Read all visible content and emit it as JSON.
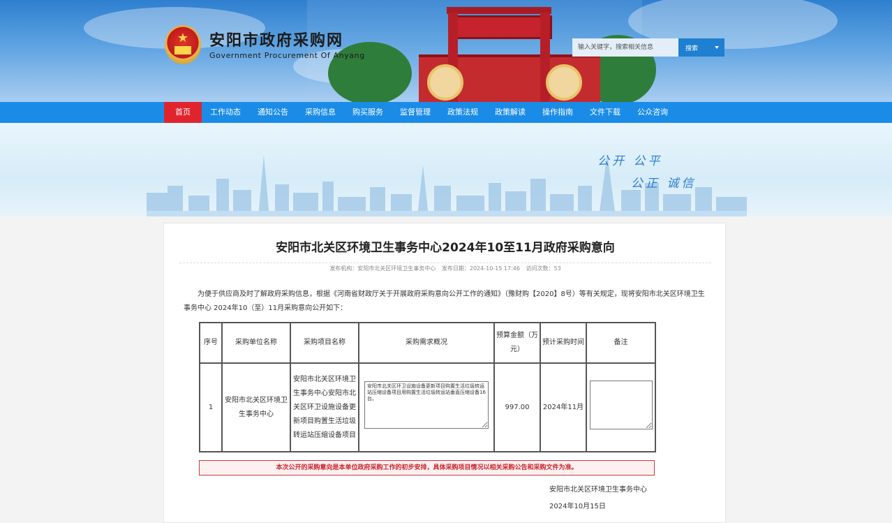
{
  "header": {
    "site_title": "安阳市政府采购网",
    "site_subtitle": "Government Procurement Of Anyang",
    "search": {
      "placeholder": "输入关键字，搜索相关信息",
      "button_label": "搜索"
    }
  },
  "nav": {
    "items": [
      "首页",
      "工作动态",
      "通知公告",
      "采购信息",
      "购买服务",
      "监督管理",
      "政策法规",
      "政策解读",
      "操作指南",
      "文件下载",
      "公众咨询"
    ],
    "active_index": 0
  },
  "banner": {
    "slogan_line1": "公开   公平",
    "slogan_line2": "公正   诚信"
  },
  "article": {
    "title": "安阳市北关区环境卫生事务中心2024年10至11月政府采购意向",
    "meta": {
      "publisher": "发布机构：安阳市北关区环境卫生事务中心",
      "date": "发布日期：2024-10-15 17:46",
      "views": "访问次数：53"
    },
    "intro": "为便于供应商及时了解政府采购信息，根据《河南省财政厅关于开展政府采购意向公开工作的通知》（豫财购【2020】8号）等有关规定，现将安阳市北关区环境卫生事务中心 2024年10（至）11月采购意向公开如下：",
    "table": {
      "headers": {
        "seq": "序号",
        "unit": "采购单位名称",
        "project": "采购项目名称",
        "requirement": "采购需求概况",
        "budget": "预算金额（万元）",
        "time": "预计采购时间",
        "remark": "备注"
      },
      "rows": [
        {
          "seq": "1",
          "unit": "安阳市北关区环境卫生事务中心",
          "project": "安阳市北关区环境卫生事务中心安阳市北关区环卫设施设备更新项目购置生活垃圾转运站压缩设备项目",
          "requirement": "安阳市北关区环卫设施设备更新项目购置生活垃圾转运站压缩设备项目用购置生活垃圾转运站垂直压缩设备16台。",
          "budget": "997.00",
          "time": "2024年11月",
          "remark": ""
        }
      ]
    },
    "notice": "本次公开的采购意向是本单位政府采购工作的初步安排，具体采购项目情况以相关采购公告和采购文件为准。",
    "signature_org": "安阳市北关区环境卫生事务中心",
    "signature_date": "2024年10月15日"
  },
  "colors": {
    "nav_bg": "#1a8ce8",
    "nav_active": "#e0242e",
    "notice_red": "#c9252d",
    "slogan_blue": "#2d7fd0"
  }
}
